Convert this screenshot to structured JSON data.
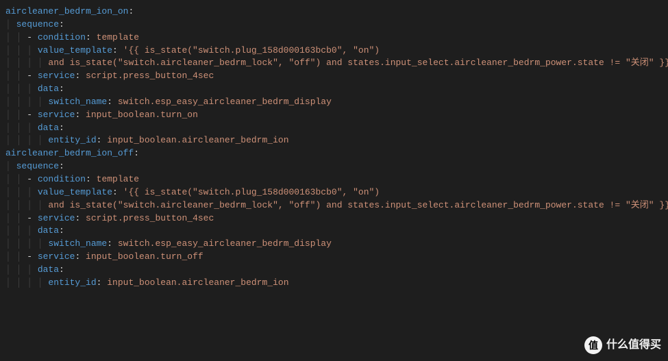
{
  "blocks": [
    {
      "name": "aircleaner_bedrm_ion_on",
      "sequence": [
        {
          "type": "condition",
          "condition": "template",
          "value_template_line1": "'{{ is_state(\"switch.plug_158d000163bcb0\", \"on\")",
          "value_template_line2": "and is_state(\"switch.aircleaner_bedrm_lock\", \"off\") and states.input_select.aircleaner_bedrm_power.state != \"关闭\" }}'"
        },
        {
          "type": "service",
          "service": "script.press_button_4sec",
          "data_key": "switch_name",
          "data_value": "switch.esp_easy_aircleaner_bedrm_display"
        },
        {
          "type": "service",
          "service": "input_boolean.turn_on",
          "data_key": "entity_id",
          "data_value": "input_boolean.aircleaner_bedrm_ion"
        }
      ]
    },
    {
      "name": "aircleaner_bedrm_ion_off",
      "sequence": [
        {
          "type": "condition",
          "condition": "template",
          "value_template_line1": "'{{ is_state(\"switch.plug_158d000163bcb0\", \"on\")",
          "value_template_line2": "and is_state(\"switch.aircleaner_bedrm_lock\", \"off\") and states.input_select.aircleaner_bedrm_power.state != \"关闭\" }}'"
        },
        {
          "type": "service",
          "service": "script.press_button_4sec",
          "data_key": "switch_name",
          "data_value": "switch.esp_easy_aircleaner_bedrm_display"
        },
        {
          "type": "service",
          "service": "input_boolean.turn_off",
          "data_key": "entity_id",
          "data_value": "input_boolean.aircleaner_bedrm_ion"
        }
      ]
    }
  ],
  "labels": {
    "sequence": "sequence",
    "condition": "condition",
    "value_template": "value_template",
    "service": "service",
    "data": "data"
  },
  "watermark": {
    "badge": "值",
    "text": "什么值得买"
  }
}
